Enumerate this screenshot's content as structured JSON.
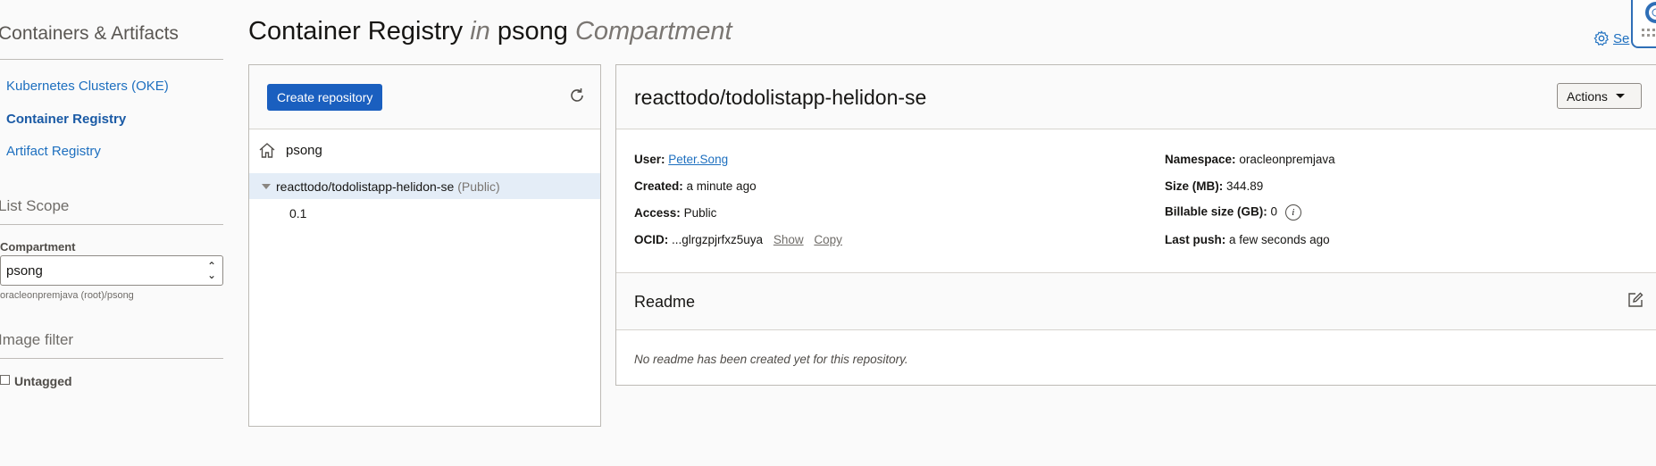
{
  "sidebar": {
    "title": "Containers & Artifacts",
    "links": [
      {
        "label": "Kubernetes Clusters (OKE)",
        "active": false
      },
      {
        "label": "Container Registry",
        "active": true
      },
      {
        "label": "Artifact Registry",
        "active": false
      }
    ],
    "list_scope_heading": "List Scope",
    "compartment_label": "Compartment",
    "compartment_value": "psong",
    "compartment_path": "oracleonpremjava (root)/psong",
    "image_filter_heading": "Image filter",
    "untagged_label": "Untagged"
  },
  "page": {
    "title_main": "Container Registry",
    "title_in": "in",
    "title_compartment": "psong",
    "title_suffix": "Compartment"
  },
  "top_right": {
    "settings_label": "Se"
  },
  "tree": {
    "create_button": "Create repository",
    "root_label": "psong",
    "repo_label": "reacttodo/todolistapp-helidon-se",
    "repo_visibility": "(Public)",
    "tag_label": "0.1"
  },
  "detail": {
    "repo_title": "reacttodo/todolistapp-helidon-se",
    "actions_label": "Actions",
    "user_key": "User:",
    "user_value": "Peter.Song",
    "created_key": "Created:",
    "created_value": "a minute ago",
    "access_key": "Access:",
    "access_value": "Public",
    "ocid_key": "OCID:",
    "ocid_value": "...glrgzpjrfxz5uya",
    "show_label": "Show",
    "copy_label": "Copy",
    "namespace_key": "Namespace:",
    "namespace_value": "oracleonpremjava",
    "size_key": "Size (MB):",
    "size_value": "344.89",
    "billable_key": "Billable size (GB):",
    "billable_value": "0",
    "info_glyph": "i",
    "last_push_key": "Last push:",
    "last_push_value": "a few seconds ago",
    "readme_title": "Readme",
    "readme_empty": "No readme has been created yet for this repository."
  },
  "colors": {
    "accent": "#1a5fbf",
    "link": "#1d6fbf",
    "selected_row": "#e4edf7"
  }
}
